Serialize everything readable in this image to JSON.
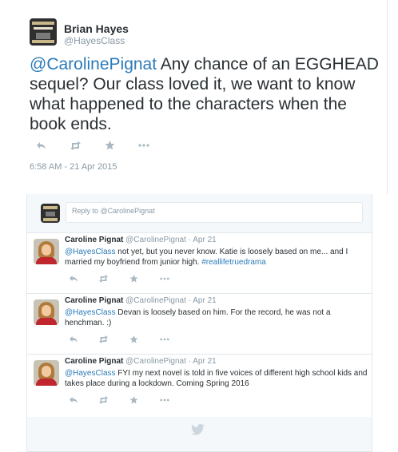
{
  "tweet": {
    "author_name": "Brian Hayes",
    "author_handle": "@HayesClass",
    "mention": "@CarolinePignat",
    "text": " Any chance of an EGGHEAD sequel? Our class loved it, we want to know what happened to the characters when the book ends.",
    "timestamp": "6:58 AM - 21 Apr 2015",
    "icons": [
      "reply-icon",
      "retweet-icon",
      "favorite-icon",
      "more-icon"
    ]
  },
  "reply_box": {
    "placeholder": "Reply to @CarolinePignat"
  },
  "replies": [
    {
      "name": "Caroline Pignat",
      "handle": "@CarolinePignat",
      "date": "· Apr 21",
      "mention": "@HayesClass",
      "text": " not yet, but you never know. Katie is loosely based on me... and I married my boyfriend from junior high. ",
      "hashtag": "#reallifetruedrama"
    },
    {
      "name": "Caroline Pignat",
      "handle": "@CarolinePignat",
      "date": "· Apr 21",
      "mention": "@HayesClass",
      "text": " Devan is loosely based on him. For the record, he was not a henchman. :)"
    },
    {
      "name": "Caroline Pignat",
      "handle": "@CarolinePignat",
      "date": "· Apr 21",
      "mention": "@HayesClass",
      "text": " FYI my next novel is told in five voices of different high school kids and takes place during a lockdown. Coming Spring 2016"
    }
  ],
  "colors": {
    "link": "#2b7bb9",
    "muted": "#8899a6",
    "icon": "#aab8c2"
  }
}
